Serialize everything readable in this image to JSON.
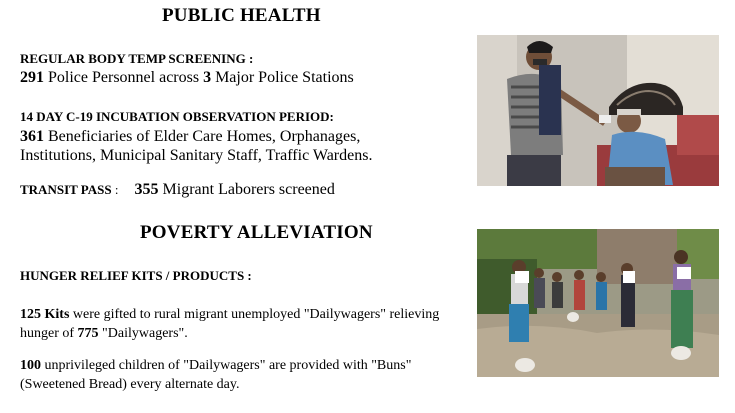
{
  "public_health": {
    "title": "PUBLIC HEALTH",
    "temp": {
      "label": "REGULAR BODY TEMP SCREENING :",
      "count": "291",
      "text1": " Police Personnel across ",
      "count2": "3",
      "text2": " Major Police Stations"
    },
    "incubation": {
      "label": "14 DAY C-19 INCUBATION OBSERVATION PERIOD:",
      "count": "361",
      "line1": " Beneficiaries of Elder Care Homes, Orphanages,",
      "line2": "Institutions, Municipal Sanitary Staff, Traffic Wardens."
    },
    "transit": {
      "label": "TRANSIT PASS",
      "sep": " :",
      "count": "355",
      "text": " Migrant Laborers screened"
    }
  },
  "poverty": {
    "title": "POVERTY ALLEVIATION",
    "kits_label": "HUNGER RELIEF KITS / PRODUCTS :",
    "para1": {
      "count": "125 Kits",
      "text1": " were gifted to rural migrant unemployed \"Dailywagers\" relieving",
      "text2": "hunger of ",
      "count2": "775",
      "text3": " \"Dailywagers\"."
    },
    "para2": {
      "count": "100",
      "text1": " unprivileged children of \"Dailywagers\" are provided with \"Buns\"",
      "text2": "(Sweetened Bread) every alternate day."
    }
  },
  "photos": {
    "top_alt": "temperature screening photo",
    "bottom_alt": "relief distribution photo"
  }
}
